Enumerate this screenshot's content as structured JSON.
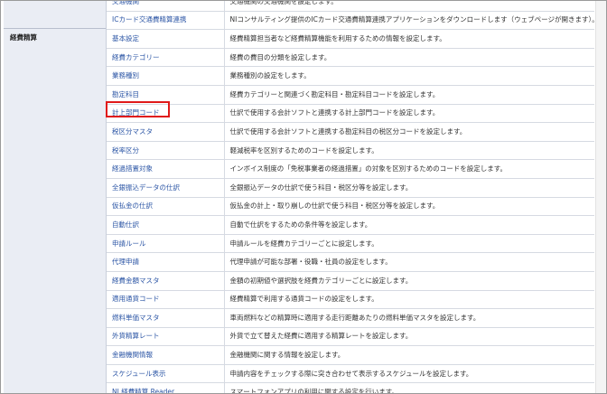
{
  "category": {
    "label": "経費精算"
  },
  "rows": [
    {
      "name": "交通機関",
      "desc": "交通機関の交通機関を設定します。"
    },
    {
      "name": "ICカード交通費精算連携",
      "desc": "NIコンサルティング提供のICカード交通費精算連携アプリケーションをダウンロードします（ウェブページが開きます）。"
    },
    {
      "name": "基本設定",
      "desc": "経費精算担当者など経費精算機能を利用するための情報を設定します。"
    },
    {
      "name": "経費カテゴリー",
      "desc": "経費の費目の分類を設定します。"
    },
    {
      "name": "業務種別",
      "desc": "業務種別の設定をします。"
    },
    {
      "name": "勘定科目",
      "desc": "経費カテゴリーと関連づく勘定科目・勘定科目コードを設定します。"
    },
    {
      "name": "計上部門コード",
      "desc": "仕訳で使用する会計ソフトと連携する計上部門コードを設定します。"
    },
    {
      "name": "税区分マスタ",
      "desc": "仕訳で使用する会計ソフトと連携する勘定科目の税区分コードを設定します。"
    },
    {
      "name": "税率区分",
      "desc": "軽減税率を区別するためのコードを設定します。"
    },
    {
      "name": "経過措置対象",
      "desc": "インボイス制度の「免税事業者の経過措置」の対象を区別するためのコードを設定します。"
    },
    {
      "name": "全銀振込データの仕訳",
      "desc": "全銀振込データの仕訳で使う科目・税区分等を設定します。"
    },
    {
      "name": "仮払金の仕訳",
      "desc": "仮払金の計上・取り崩しの仕訳で使う科目・税区分等を設定します。"
    },
    {
      "name": "自動仕訳",
      "desc": "自動で仕訳をするための条件等を設定します。"
    },
    {
      "name": "申請ルール",
      "desc": "申請ルールを経費カテゴリーごとに設定します。"
    },
    {
      "name": "代理申請",
      "desc": "代理申請が可能な部署・役職・社員の設定をします。"
    },
    {
      "name": "経費金額マスタ",
      "desc": "金額の初期値や選択肢を経費カテゴリーごとに設定します。"
    },
    {
      "name": "適用通貨コード",
      "desc": "経費精算で利用する通貨コードの設定をします。"
    },
    {
      "name": "燃料単価マスタ",
      "desc": "車両燃料などの精算時に適用する走行距離あたりの燃料単価マスタを設定します。"
    },
    {
      "name": "外貨精算レート",
      "desc": "外貨で立て替えた経費に適用する精算レートを設定します。"
    },
    {
      "name": "金融機関情報",
      "desc": "金融機関に関する情報を設定します。"
    },
    {
      "name": "スケジュール表示",
      "desc": "申請内容をチェックする際に突き合わせて表示するスケジュールを設定します。"
    },
    {
      "name": "NI 経費精算 Reader",
      "desc": "スマートフォンアプリの利用に関する設定を行います。"
    }
  ]
}
